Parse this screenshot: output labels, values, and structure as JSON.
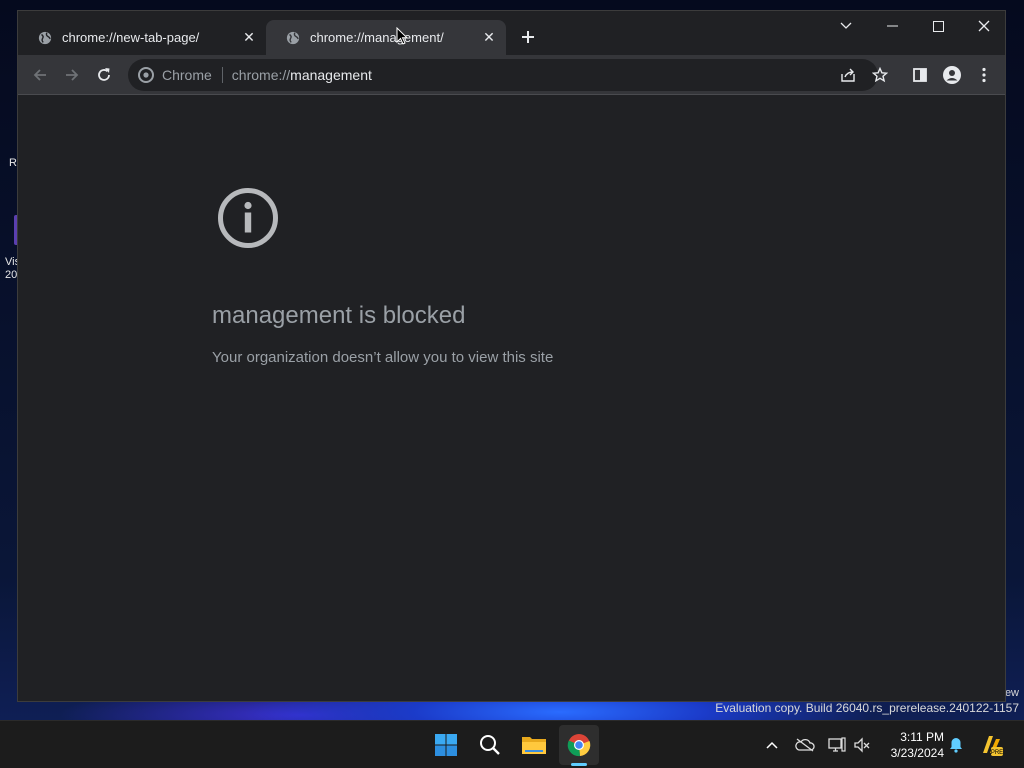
{
  "desktop": {
    "icon_label_top": "R",
    "icon_label_line1": "Vis",
    "icon_label_line2": "20",
    "watermark_line1": "ew",
    "watermark_line2": "Evaluation copy. Build 26040.rs_prerelease.240122-1157"
  },
  "browser": {
    "tabs": [
      {
        "title": "chrome://new-tab-page/",
        "active": false
      },
      {
        "title": "chrome://management/",
        "active": true
      }
    ],
    "omnibox": {
      "origin_label": "Chrome",
      "url_scheme": "chrome://",
      "url_host": "management"
    },
    "page": {
      "heading": "management is blocked",
      "body": "Your organization doesn’t allow you to view this site"
    }
  },
  "taskbar": {
    "time": "3:11 PM",
    "date": "3/23/2024",
    "accent": "#60cdff"
  }
}
